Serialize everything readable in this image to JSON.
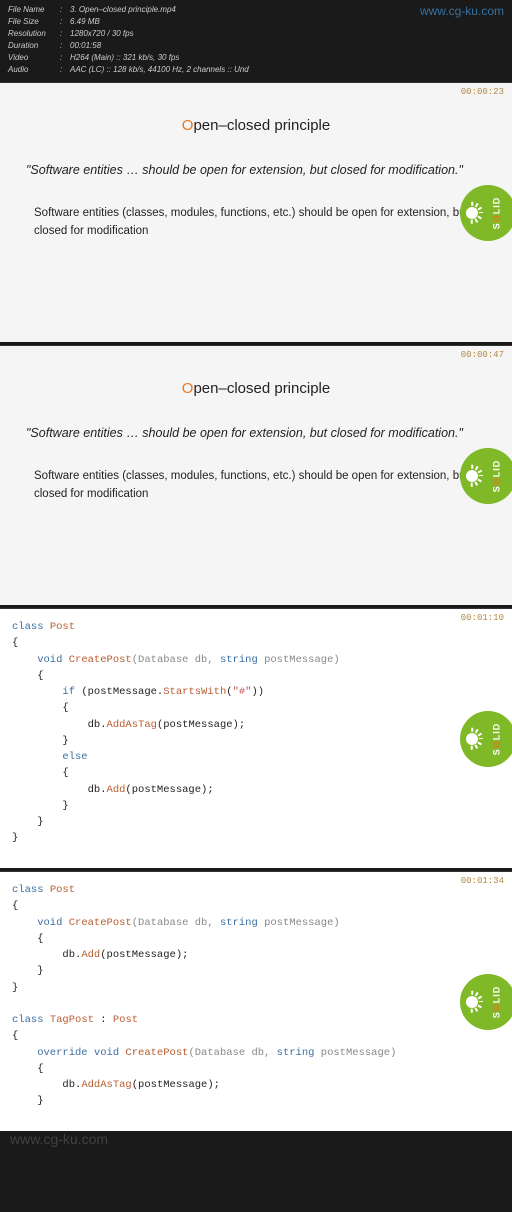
{
  "watermark": {
    "top": "www.cg-ku.com",
    "bottom": "www.cg-ku.com"
  },
  "meta": {
    "filename_label": "File Name",
    "filename": "3. Open–closed principle.mp4",
    "filesize_label": "File Size",
    "filesize": "6.49 MB",
    "resolution_label": "Resolution",
    "resolution": "1280x720 / 30 fps",
    "duration_label": "Duration",
    "duration": "00:01:58",
    "video_label": "Video",
    "video": "H264 (Main) :: 321 kb/s, 30 fps",
    "audio_label": "Audio",
    "audio": "AAC (LC) :: 128 kb/s, 44100 Hz, 2 channels :: Und"
  },
  "badge": {
    "text_pre": "S",
    "text_o": "O",
    "text_post": "LID"
  },
  "slides": [
    {
      "timestamp": "00:00:23",
      "title_o": "O",
      "title_rest": "pen–closed principle",
      "quote": "\"Software entities … should be open for extension, but closed for modification.\"",
      "desc": "Software entities (classes, modules, functions, etc.) should be open for extension, but closed for modification"
    },
    {
      "timestamp": "00:00:47",
      "title_o": "O",
      "title_rest": "pen–closed principle",
      "quote": "\"Software entities … should be open for extension, but closed for modification.\"",
      "desc": "Software entities (classes, modules, functions, etc.) should be open for extension, but closed for modification"
    },
    {
      "timestamp": "00:01:10"
    },
    {
      "timestamp": "00:01:34"
    }
  ],
  "code3": {
    "l1a": "class",
    "l1b": " Post",
    "l2": "{",
    "l3a": "    void",
    "l3b": " CreatePost",
    "l3c": "(Database db, ",
    "l3d": "string",
    "l3e": " postMessage)",
    "l4": "    {",
    "l5a": "        if",
    "l5b": " (postMessage.",
    "l5c": "StartsWith",
    "l5d": "(",
    "l5e": "\"#\"",
    "l5f": "))",
    "l6": "        {",
    "l7a": "            db.",
    "l7b": "AddAsTag",
    "l7c": "(postMessage);",
    "l8": "        }",
    "l9a": "        else",
    "l10": "        {",
    "l11a": "            db.",
    "l11b": "Add",
    "l11c": "(postMessage);",
    "l12": "        }",
    "l13": "    }",
    "l14": "}"
  },
  "code4": {
    "a1a": "class",
    "a1b": " Post",
    "a2": "{",
    "a3a": "    void",
    "a3b": " CreatePost",
    "a3c": "(Database db, ",
    "a3d": "string",
    "a3e": " postMessage)",
    "a4": "    {",
    "a5a": "        db.",
    "a5b": "Add",
    "a5c": "(postMessage);",
    "a6": "    }",
    "a7": "}",
    "gap": " ",
    "b1a": "class",
    "b1b": " TagPost",
    "b1c": " : ",
    "b1d": "Post",
    "b2": "{",
    "b3a": "    override void",
    "b3b": " CreatePost",
    "b3c": "(Database db, ",
    "b3d": "string",
    "b3e": " postMessage)",
    "b4": "    {",
    "b5a": "        db.",
    "b5b": "AddAsTag",
    "b5c": "(postMessage);",
    "b6": "    }"
  }
}
